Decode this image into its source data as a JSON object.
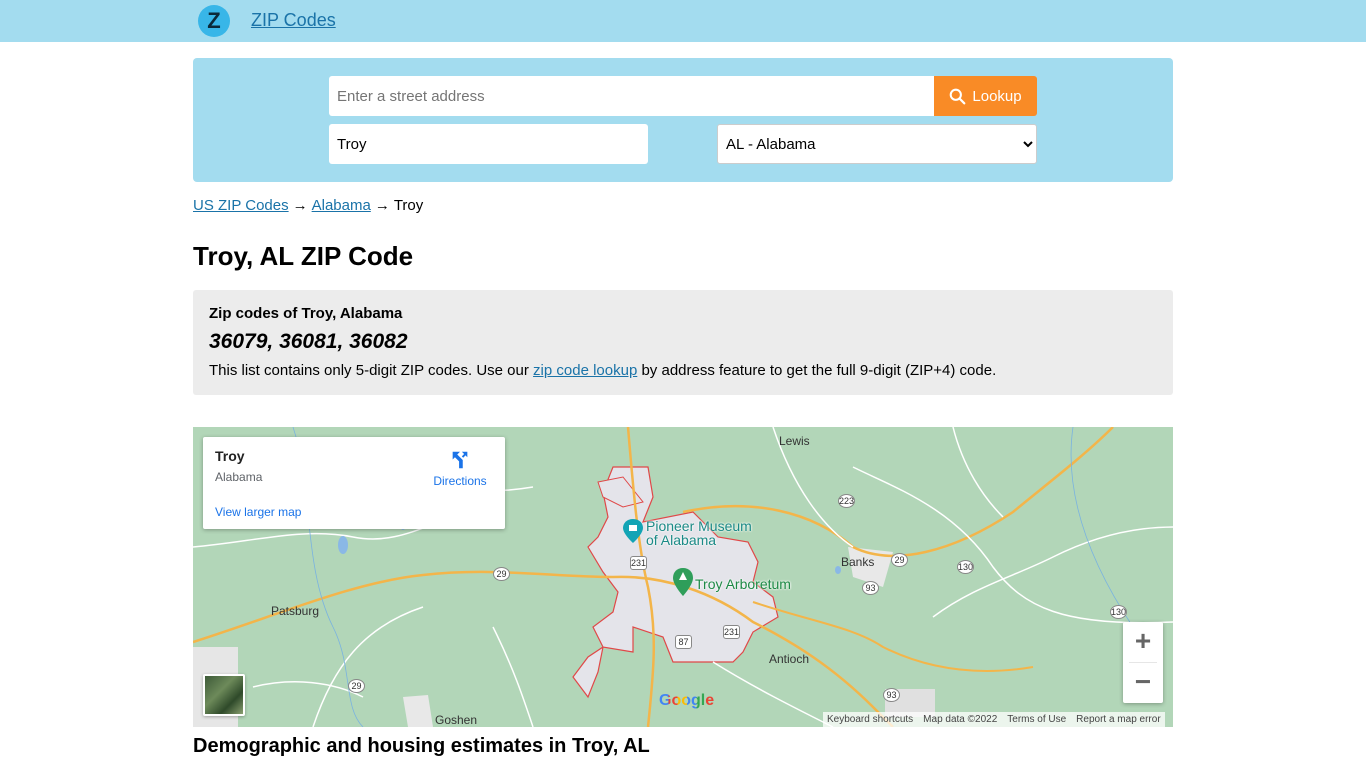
{
  "header": {
    "logo_letter": "Z",
    "site_name": "ZIP Codes"
  },
  "search": {
    "address_placeholder": "Enter a street address",
    "lookup_label": "Lookup",
    "city_value": "Troy",
    "state_selected": "AL - Alabama"
  },
  "breadcrumb": {
    "home": "US ZIP Codes",
    "arrow": "→",
    "state": "Alabama",
    "current": "Troy"
  },
  "page": {
    "title": "Troy, AL ZIP Code"
  },
  "zip_info": {
    "heading": "Zip codes of Troy, Alabama",
    "codes": "36079, 36081, 36082",
    "note_before": "This list contains only 5-digit ZIP codes. Use our",
    "note_link": "zip code lookup",
    "note_after": "by address feature to get the full 9-digit (ZIP+4) code."
  },
  "map": {
    "place_name": "Troy",
    "place_state": "Alabama",
    "directions_label": "Directions",
    "larger_map_label": "View larger map",
    "poi_museum": "Pioneer Museum\nof Alabama",
    "poi_arboretum": "Troy Arboretum",
    "towns": {
      "lewis": "Lewis",
      "banks": "Banks",
      "patsburg": "Patsburg",
      "antioch": "Antioch",
      "goshen": "Goshen"
    },
    "shields": {
      "r223": "223",
      "r29a": "29",
      "r29b": "29",
      "r29c": "29",
      "r130a": "130",
      "r130b": "130",
      "r93a": "93",
      "r93b": "93",
      "r231a": "231",
      "r231b": "231",
      "r87": "87"
    },
    "google": "Google",
    "attribution": {
      "shortcuts": "Keyboard shortcuts",
      "data": "Map data ©2022",
      "terms": "Terms of Use",
      "report": "Report a map error"
    },
    "zoom_in": "+",
    "zoom_out": "−"
  },
  "section": {
    "demographics_heading": "Demographic and housing estimates in Troy, AL"
  },
  "colors": {
    "topbar": "#a3dcef",
    "lookup_button": "#f98b26",
    "link": "#1a73a8",
    "map_green": "#b2d6b8",
    "boundary": "#e04848"
  }
}
